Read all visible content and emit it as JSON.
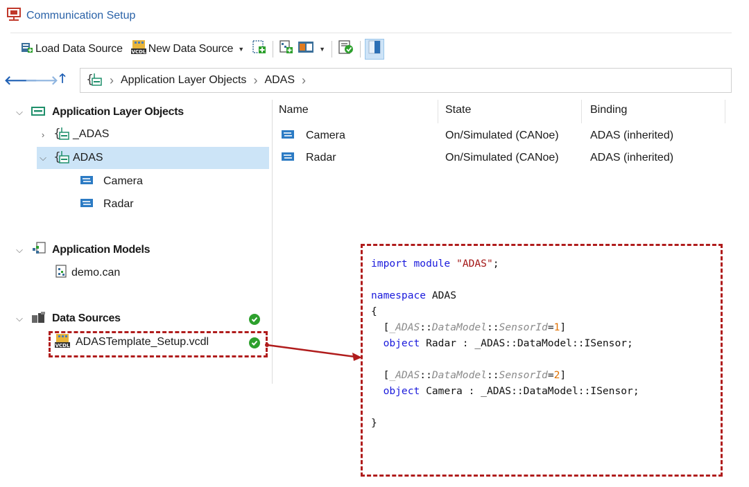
{
  "window": {
    "title": "Communication Setup"
  },
  "toolbar": {
    "load_label": "Load Data Source",
    "new_label": "New Data Source"
  },
  "address": {
    "crumbs": [
      "Application Layer Objects",
      "ADAS"
    ]
  },
  "tree": {
    "alo_label": "Application Layer Objects",
    "alo_items": [
      "_ADAS",
      "ADAS"
    ],
    "adas_children": [
      "Camera",
      "Radar"
    ],
    "models_label": "Application Models",
    "models_items": [
      "demo.can"
    ],
    "sources_label": "Data Sources",
    "sources_items": [
      "ADASTemplate_Setup.vcdl"
    ]
  },
  "list": {
    "columns": [
      "Name",
      "State",
      "Binding"
    ],
    "rows": [
      {
        "name": "Camera",
        "state": "On/Simulated (CANoe)",
        "binding": "ADAS (inherited)"
      },
      {
        "name": "Radar",
        "state": "On/Simulated (CANoe)",
        "binding": "ADAS (inherited)"
      }
    ]
  },
  "code": {
    "l1_kw": "import module",
    "l1_str": "\"ADAS\"",
    "l1_end": ";",
    "l3_kw": "namespace",
    "l3_rest": " ADAS",
    "l4": "{",
    "a1_open": "  [",
    "a1_ns": "_ADAS",
    "a1_sep1": "::",
    "a1_dm": "DataModel",
    "a1_sep2": "::",
    "a1_sid": "SensorId",
    "a1_eq": "=",
    "a1_num": "1",
    "a1_close": "]",
    "o1_kw": "  object",
    "o1_rest": " Radar : _ADAS::DataModel::ISensor;",
    "a2_open": "  [",
    "a2_ns": "_ADAS",
    "a2_sep1": "::",
    "a2_dm": "DataModel",
    "a2_sep2": "::",
    "a2_sid": "SensorId",
    "a2_eq": "=",
    "a2_num": "2",
    "a2_close": "]",
    "o2_kw": "  object",
    "o2_rest": " Camera : _ADAS::DataModel::ISensor;",
    "last": "}"
  },
  "icons": {
    "status_ok_color": "#2da02d",
    "accent": "#2a62a8",
    "highlight_color": "#b01c1c"
  }
}
